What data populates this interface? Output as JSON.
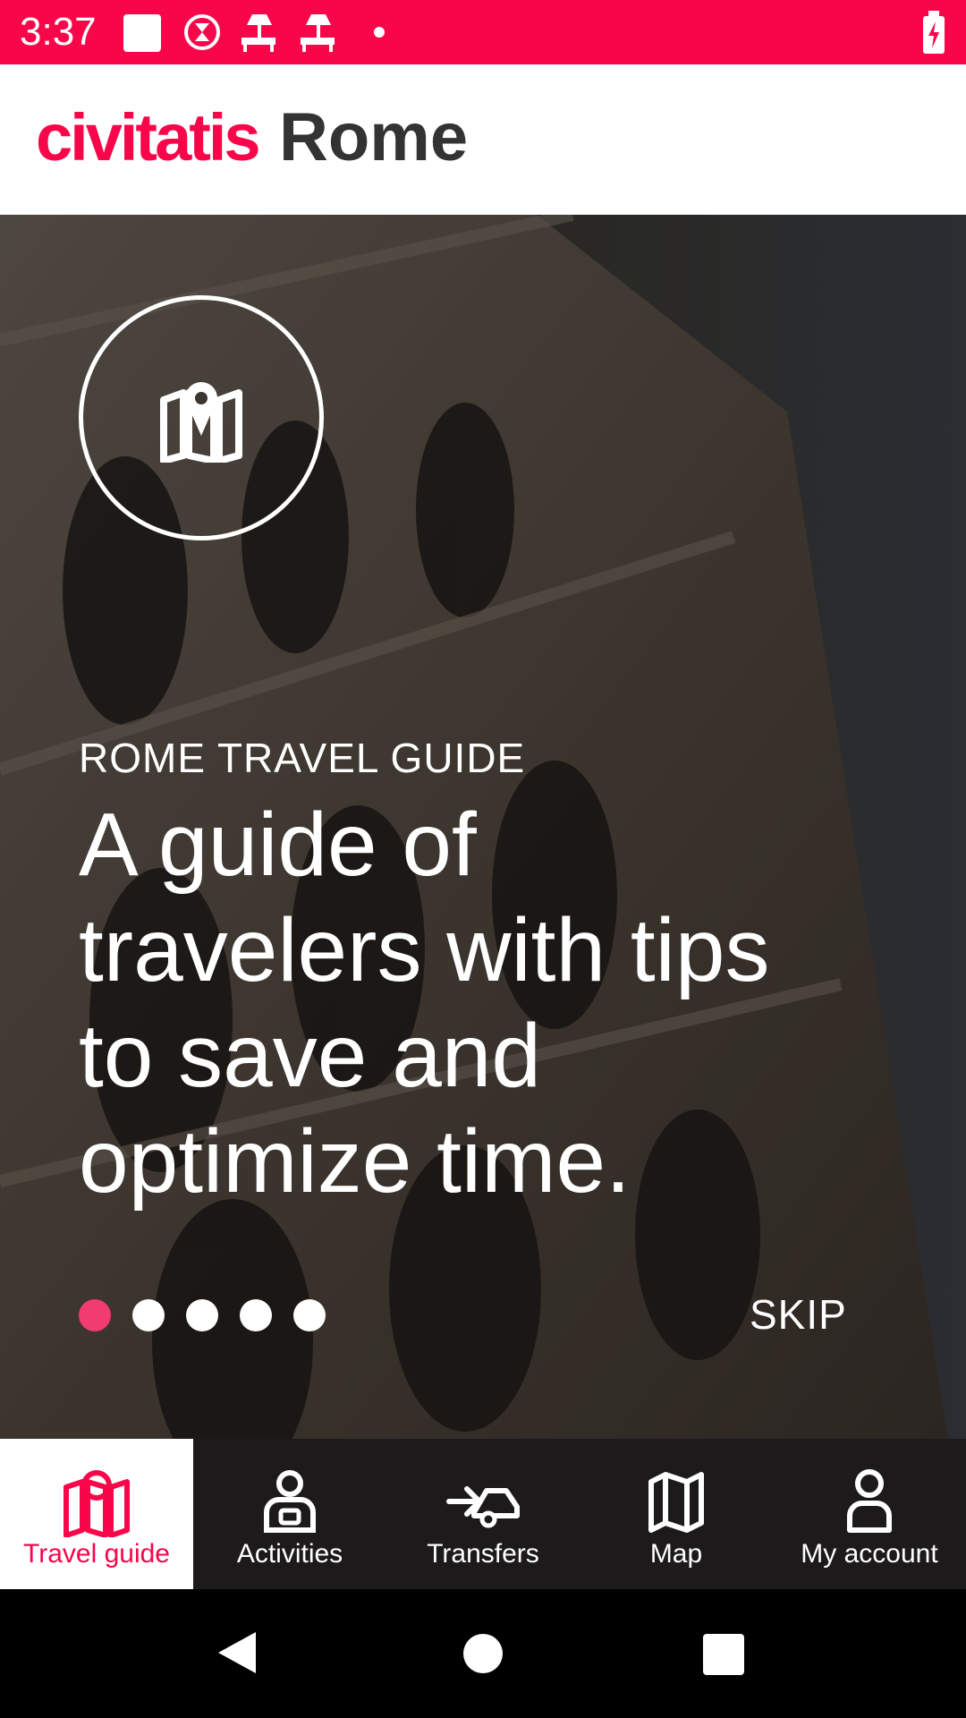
{
  "status_bar": {
    "time": "3:37",
    "icons": [
      "square-notification-icon",
      "timer-icon",
      "lamp-icon",
      "lamp-icon",
      "dot-icon",
      "battery-charging-icon"
    ],
    "background": "#f7064a"
  },
  "header": {
    "brand": "civitatis",
    "city": "Rome"
  },
  "hero": {
    "icon": "map-pin-icon",
    "kicker": "ROME TRAVEL GUIDE",
    "headline": "A guide of travelers with tips to save and optimize time.",
    "pager": {
      "total": 5,
      "active": 1
    },
    "skip_label": "SKIP"
  },
  "bottom_nav": {
    "items": [
      {
        "label": "Travel guide",
        "icon": "map-pin-icon",
        "active": true
      },
      {
        "label": "Activities",
        "icon": "ticket-person-icon",
        "active": false
      },
      {
        "label": "Transfers",
        "icon": "car-arrow-icon",
        "active": false
      },
      {
        "label": "Map",
        "icon": "map-icon",
        "active": false
      },
      {
        "label": "My account",
        "icon": "user-icon",
        "active": false
      }
    ]
  },
  "colors": {
    "accent": "#f7064a",
    "pager_active": "#f23b6e",
    "nav_background": "#1c1a1b"
  },
  "system_nav": {
    "icons": [
      "back-icon",
      "home-icon",
      "recents-icon"
    ]
  }
}
